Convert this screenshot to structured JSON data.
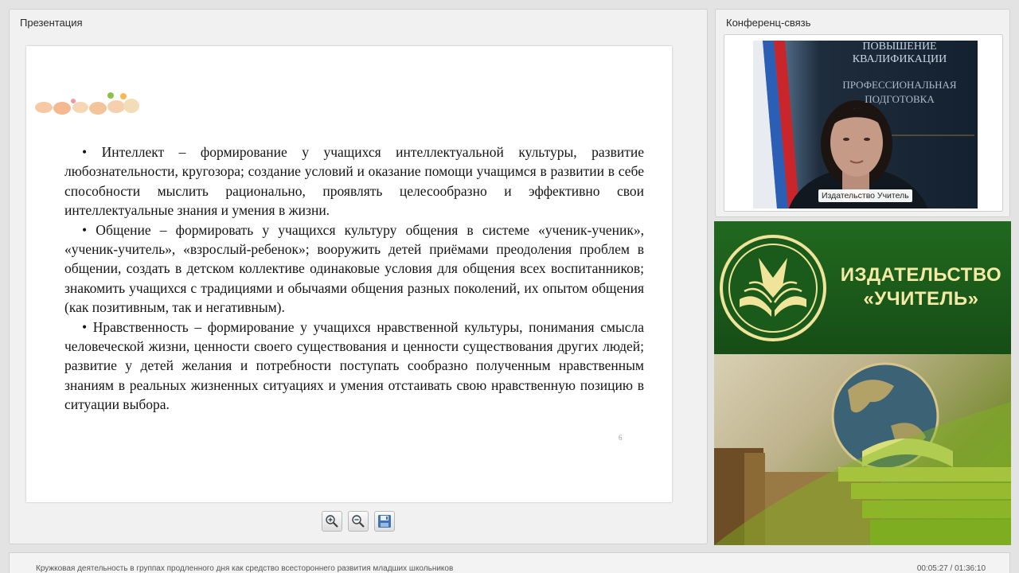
{
  "presentation": {
    "title": "Презентация",
    "slide": {
      "paragraphs": [
        "• Интеллект – формирование у учащихся интеллектуальной культуры, развитие любознательности, кругозора; создание условий и оказание помощи учащимся в развитии в себе способности мыслить рационально, проявлять целесообразно и эффективно свои интеллектуальные знания и умения в жизни.",
        "• Общение – формировать у учащихся культуру общения в системе «ученик-ученик», «ученик-учитель», «взрослый-ребенок»; вооружить детей приёмами преодоления проблем в общении, создать в детском коллективе одинаковые условия для общения всех воспитанников; знакомить учащихся с традициями и обычаями общения разных поколений, их опытом общения (как позитивным, так и негативным).",
        "• Нравственность – формирование у учащихся нравственной культуры, понимания смысла человеческой жизни, ценности своего существования и ценности существования других людей; развитие у детей желания и потребности поступать сообразно полученным нравственным знаниям в реальных жизненных ситуациях и умения отстаивать свою нравственную позицию в ситуации выбора."
      ],
      "page_number": "6"
    },
    "toolbar": [
      {
        "name": "zoom-in-button",
        "icon": "zoom-in-icon"
      },
      {
        "name": "zoom-out-button",
        "icon": "zoom-out-icon"
      },
      {
        "name": "save-button",
        "icon": "floppy-disk-icon"
      }
    ]
  },
  "conference": {
    "title": "Конференц-связь",
    "video": {
      "speaker_caption": "Издательство Учитель",
      "banner_lines": [
        "ПОВЫШЕНИЕ",
        "КВАЛИФИКАЦИИ",
        "ПРОФЕССИОНАЛЬНАЯ",
        "ПОДГОТОВКА"
      ]
    }
  },
  "brand": {
    "line1": "ИЗДАТЕЛЬСТВО",
    "line2": "«УЧИТЕЛЬ»",
    "colors": {
      "green": "#1d5e1c",
      "text": "#f4eaa5"
    }
  },
  "status_bar": {
    "course_title": "Кружковая деятельность в группах продленного дня как средство всестороннего развития младших школьников",
    "time": "00:05:27 / 01:36:10"
  }
}
